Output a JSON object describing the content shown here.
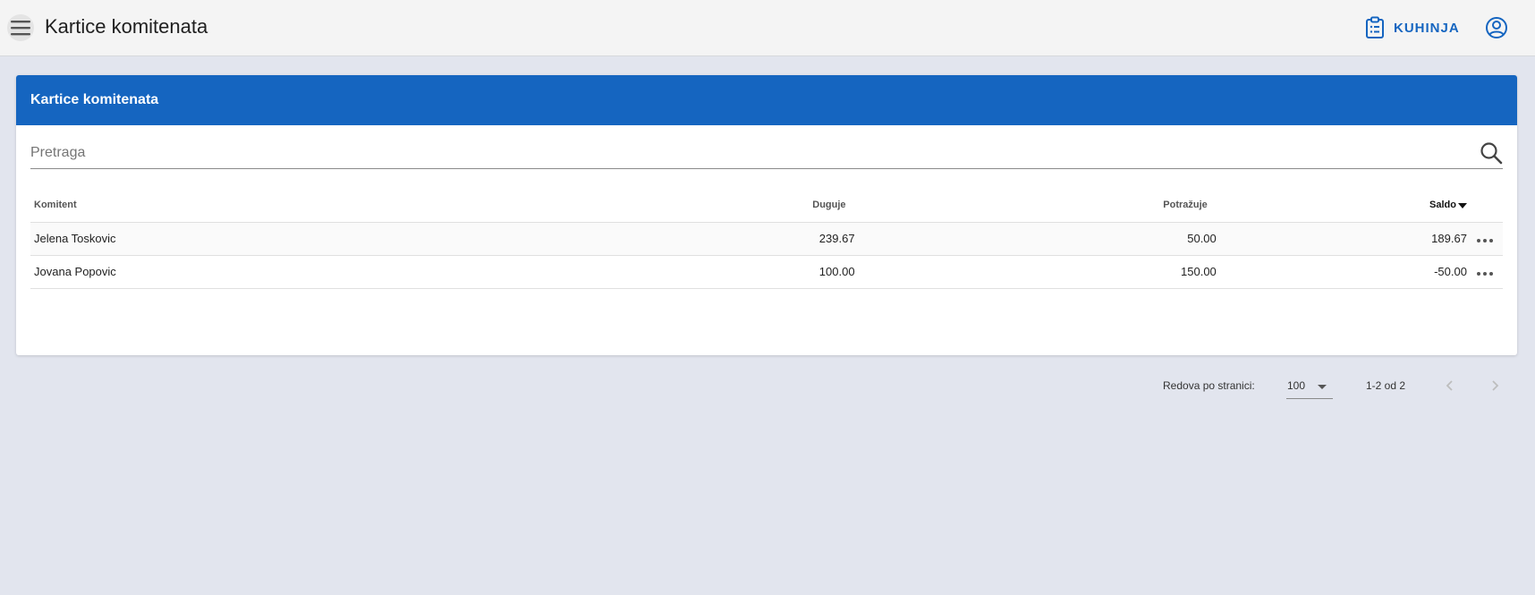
{
  "appbar": {
    "title": "Kartice komitenata",
    "kitchen_label": "KUHINJA"
  },
  "card": {
    "title": "Kartice komitenata"
  },
  "search": {
    "placeholder": "Pretraga",
    "value": ""
  },
  "table": {
    "headers": {
      "name": "Komitent",
      "debit": "Duguje",
      "credit": "Potražuje",
      "saldo": "Saldo"
    },
    "sort": {
      "column": "saldo",
      "direction": "desc"
    },
    "rows": [
      {
        "name": "Jelena Toskovic",
        "debit": "239.67",
        "credit": "50.00",
        "saldo": "189.67"
      },
      {
        "name": "Jovana Popovic",
        "debit": "100.00",
        "credit": "150.00",
        "saldo": "-50.00"
      }
    ]
  },
  "pagination": {
    "rows_label": "Redova po stranici:",
    "rows_per_page": "100",
    "range": "1-2 od 2"
  },
  "colors": {
    "primary": "#1565c0",
    "appbar_bg": "#f4f4f4",
    "page_bg": "#e2e5ee"
  },
  "icons": {
    "menu": "hamburger-icon",
    "kitchen": "clipboard-list-icon",
    "user": "account-circle-icon",
    "search": "search-icon",
    "sort": "sort-desc-arrow-icon",
    "row_actions": "more-horizontal-icon",
    "prev": "chevron-left-icon",
    "next": "chevron-right-icon"
  }
}
